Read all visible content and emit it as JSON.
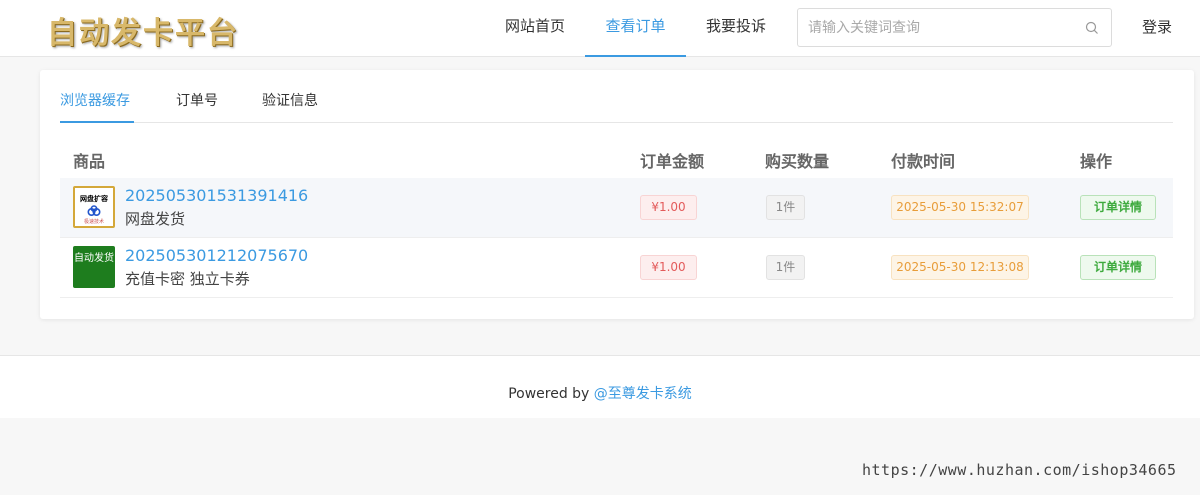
{
  "header": {
    "logo_text": "自动发卡平台",
    "nav": [
      "网站首页",
      "查看订单",
      "我要投诉"
    ],
    "active_nav_index": 1,
    "search": {
      "placeholder": "请输入关键词查询",
      "value": ""
    },
    "login_label": "登录"
  },
  "tabs": {
    "items": [
      "浏览器缓存",
      "订单号",
      "验证信息"
    ],
    "active_index": 0
  },
  "table": {
    "columns": [
      "商品",
      "订单金额",
      "购买数量",
      "付款时间",
      "操作"
    ],
    "rows": [
      {
        "thumb_title": "网盘扩容",
        "thumb_caption": "极速技术",
        "order_no": "202505301531391416",
        "product": "网盘发货",
        "amount": "¥1.00",
        "quantity": "1件",
        "paid_time": "2025-05-30 15:32:07",
        "action": "订单详情"
      },
      {
        "thumb_title": "自动发货",
        "order_no": "202505301212075670",
        "product": "充值卡密 独立卡券",
        "amount": "¥1.00",
        "quantity": "1件",
        "paid_time": "2025-05-30 12:13:08",
        "action": "订单详情"
      }
    ]
  },
  "footer": {
    "prefix": "Powered by ",
    "link": "@至尊发卡系统"
  },
  "watermark": "https://www.huzhan.com/ishop34665",
  "colors": {
    "accent": "#3b9ae1",
    "price": "#e35b5b",
    "time": "#e89d3a",
    "action": "#3eaa3e",
    "logo": "#d8b86a"
  }
}
